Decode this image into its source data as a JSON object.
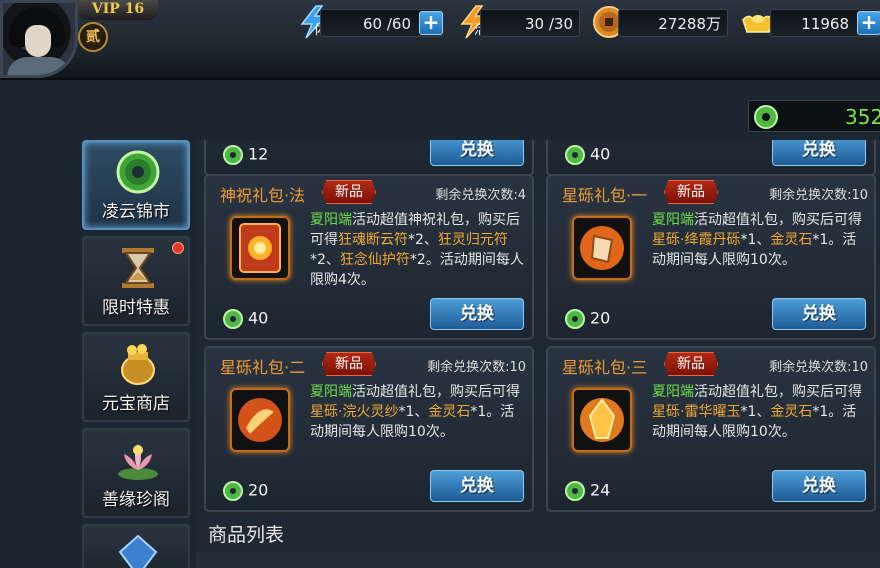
{
  "header": {
    "vip": "VIP 16",
    "rank": "贰",
    "stamina": {
      "label": "体",
      "value": "60 /60"
    },
    "activity": {
      "label": "活",
      "value": "30 /30"
    },
    "copper": {
      "value": "27288万"
    },
    "gold": {
      "value": "11968"
    },
    "jade": {
      "value": "352"
    }
  },
  "sidebar": {
    "items": [
      {
        "label": "凌云锦市",
        "icon": "jade-coin-icon",
        "active": true
      },
      {
        "label": "限时特惠",
        "icon": "hourglass-icon",
        "badge": true
      },
      {
        "label": "元宝商店",
        "icon": "treasure-pot-icon"
      },
      {
        "label": "善缘珍阁",
        "icon": "lotus-icon"
      }
    ]
  },
  "top_prices": [
    "12",
    "40"
  ],
  "cards": [
    {
      "title": "神祝礼包·法",
      "badge": "新品",
      "remain": "剩余兑换次数:4",
      "desc_source": "夏阳端",
      "desc_a": "活动超值神祝礼包，购买后可得",
      "item1": "狂魂断云符",
      "qty1": "*2、",
      "item2": "狂灵归元符",
      "qty2": "*2、",
      "item3": "狂念仙护符",
      "qty3": "*2。活动期间每人限购4次。",
      "price": "40",
      "button": "兑换"
    },
    {
      "title": "星砾礼包·一",
      "badge": "新品",
      "remain": "剩余兑换次数:10",
      "desc_source": "夏阳端",
      "desc_a": "活动超值礼包，购买后可得",
      "item1": "星砾·绛霞丹砾",
      "qty1": "*1、",
      "item2": "金灵石",
      "qty2": "*1。活动期间每人限购10次。",
      "price": "20",
      "button": "兑换"
    },
    {
      "title": "星砾礼包·二",
      "badge": "新品",
      "remain": "剩余兑换次数:10",
      "desc_source": "夏阳端",
      "desc_a": "活动超值礼包，购买后可得",
      "item1": "星砾·浣火灵纱",
      "qty1": "*1、",
      "item2": "金灵石",
      "qty2": "*1。活动期间每人限购10次。",
      "price": "20",
      "button": "兑换"
    },
    {
      "title": "星砾礼包·三",
      "badge": "新品",
      "remain": "剩余兑换次数:10",
      "desc_source": "夏阳端",
      "desc_a": "活动超值礼包，购买后可得",
      "item1": "星砾·雷华曜玉",
      "qty1": "*1、",
      "item2": "金灵石",
      "qty2": "*1。活动期间每人限购10次。",
      "price": "24",
      "button": "兑换"
    }
  ],
  "section_title": "商品列表"
}
